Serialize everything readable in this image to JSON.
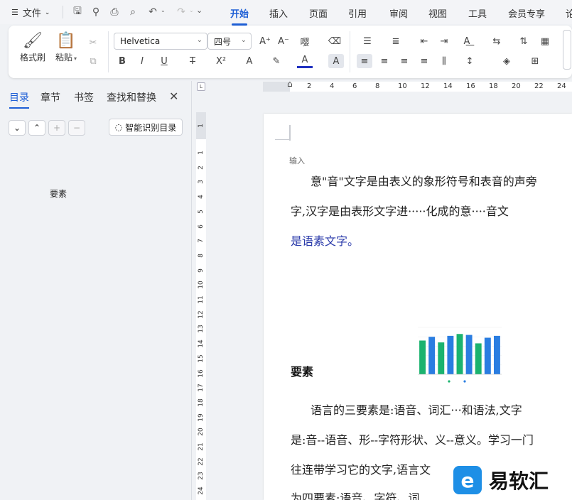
{
  "menubar": {
    "menu_icon": "☰",
    "file_label": "文件",
    "tabs": [
      "开始",
      "插入",
      "页面",
      "引用",
      "审阅",
      "视图",
      "工具",
      "会员专享",
      "论"
    ]
  },
  "ribbon": {
    "format_painter": "格式刷",
    "paste": "粘贴",
    "font_name": "Helvetica",
    "font_size": "四号"
  },
  "nav": {
    "tabs": [
      "目录",
      "章节",
      "书签",
      "查找和替换"
    ],
    "smart_toc": "智能识别目录",
    "toc_items": [
      "要素"
    ]
  },
  "ruler": {
    "h_numbers": [
      "2",
      "2",
      "4",
      "6",
      "8",
      "10",
      "12",
      "14",
      "16",
      "18",
      "20",
      "22",
      "24"
    ],
    "v_numbers": [
      "1",
      "1",
      "2",
      "3",
      "4",
      "5",
      "6",
      "7",
      "8",
      "9",
      "10",
      "11",
      "12",
      "13",
      "14",
      "15",
      "16",
      "17",
      "18",
      "19",
      "20",
      "21",
      "22",
      "23",
      "24"
    ]
  },
  "document": {
    "input_hint": "输入",
    "para1_line1": "意\"音\"文字是由表义的象形符号和表音的声旁",
    "para1_line2": "字,汉字是由表形文字进·····化成的意····音文",
    "para1_line3": "是语素文字。",
    "heading": "要素",
    "para2_line1": "语言的三要素是:语音、词汇···和语法,文字",
    "para2_line2": "是:音--语音、形--字符形状、义--意义。学习一门",
    "para2_line3": "往连带学习它的文字,语言文",
    "para2_line4": "为四要素:语音、字符、词"
  },
  "chart_data": {
    "type": "bar",
    "categories": [
      "",
      "",
      "",
      "",
      "",
      "",
      "",
      "",
      ""
    ],
    "values": [
      72,
      80,
      68,
      82,
      86,
      84,
      66,
      78,
      82
    ],
    "colors": [
      "#1bb36f",
      "#2a7de1",
      "#1bb36f",
      "#2a7de1",
      "#1bb36f",
      "#2a7de1",
      "#1bb36f",
      "#2a7de1",
      "#2a7de1"
    ],
    "ylim": [
      0,
      100
    ]
  },
  "watermark": {
    "glyph": "e",
    "text": "易软汇"
  },
  "colors": {
    "accent": "#1e5fd6",
    "link": "#2a3aaa"
  }
}
